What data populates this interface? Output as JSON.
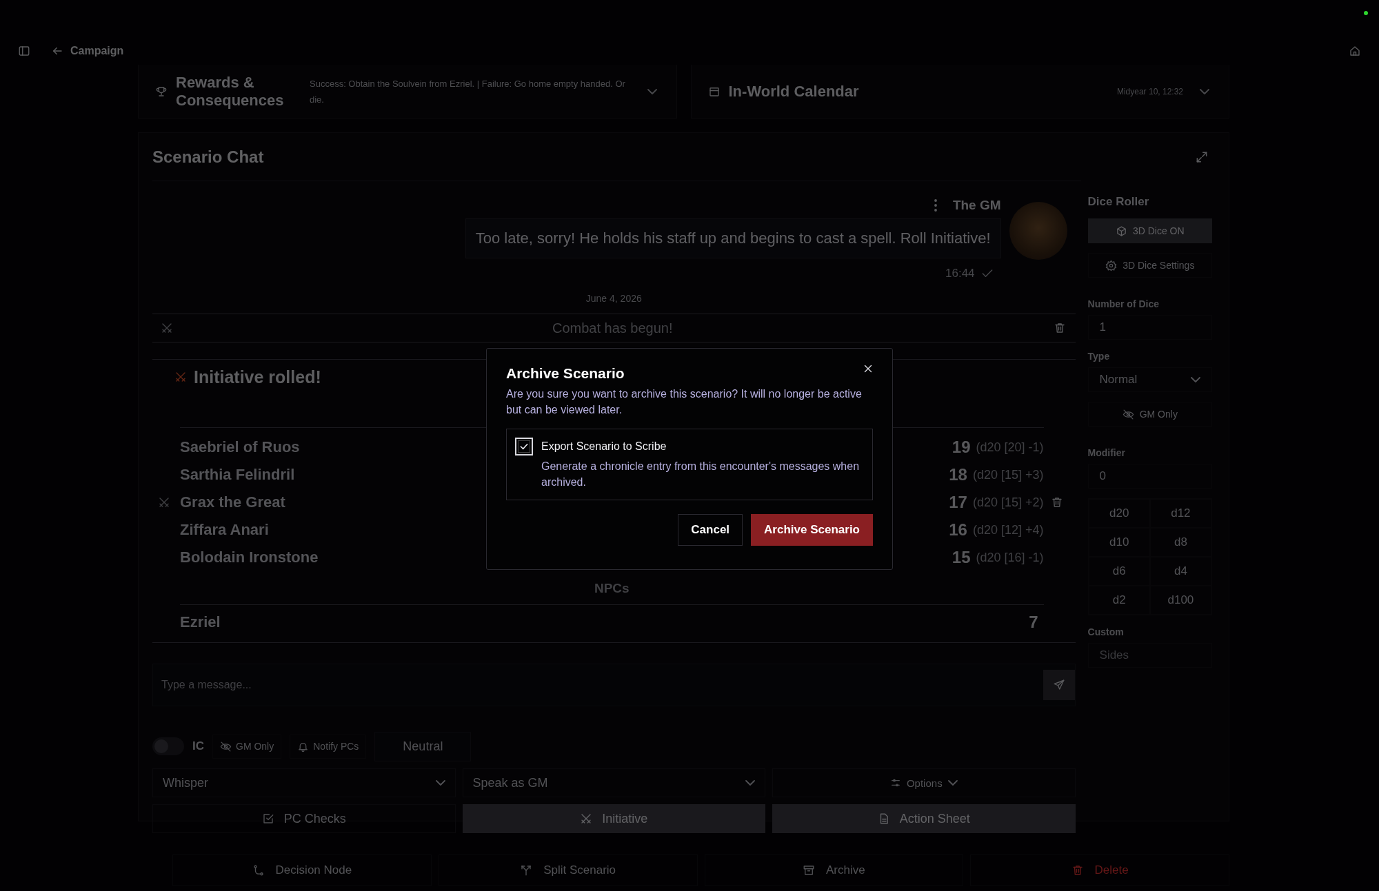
{
  "top_bar": {
    "back_label": "Campaign"
  },
  "summary_cards": [
    {
      "kind": "rewards",
      "title": "Rewards & Consequences",
      "text": "Success: Obtain the Soulvein from Ezriel. | Failure: Go home empty handed. Or die."
    },
    {
      "kind": "calendar",
      "title": "In-World Calendar",
      "value": "Midyear 10, 12:32"
    }
  ],
  "chat": {
    "title": "Scenario Chat",
    "messages": [
      {
        "author": "The GM",
        "text": "Too late, sorry! He holds his staff up and begins to cast a spell. Roll Initiative!",
        "time": "16:44",
        "read": true
      }
    ],
    "date_divider": "June 4, 2026",
    "combat_banner": "Combat has begun!",
    "initiative": {
      "title": "Initiative rolled!",
      "pcs": [
        {
          "name": "Saebriel of Ruos",
          "total": "19",
          "detail": "(d20 [20] -1)",
          "current": false
        },
        {
          "name": "Sarthia Felindril",
          "total": "18",
          "detail": "(d20 [15] +3)",
          "current": false
        },
        {
          "name": "Grax the Great",
          "total": "17",
          "detail": "(d20 [15] +2)",
          "current": true
        },
        {
          "name": "Ziffara Anari",
          "total": "16",
          "detail": "(d20 [12] +4)",
          "current": false
        },
        {
          "name": "Bolodain Ironstone",
          "total": "15",
          "detail": "(d20 [16] -1)",
          "current": false
        }
      ],
      "npc_heading": "NPCs",
      "npcs": [
        {
          "name": "Ezriel",
          "total": "7"
        }
      ]
    },
    "composer": {
      "placeholder": "Type a message...",
      "ic_toggle": {
        "label": "IC",
        "on": false
      },
      "gm_only": "GM Only",
      "notify": "Notify PCs",
      "tone": "Neutral",
      "whisper": "Whisper",
      "speaker": "Speak as GM",
      "options": "Options",
      "actions": [
        {
          "label": "PC Checks",
          "kind": "checks",
          "active": false
        },
        {
          "label": "Initiative",
          "kind": "initiative",
          "active": true
        },
        {
          "label": "Action Sheet",
          "kind": "sheet",
          "active": true
        }
      ]
    }
  },
  "dice_roller": {
    "title": "Dice Roller",
    "dice_3d": {
      "label": "3D Dice ON",
      "on": true
    },
    "settings": "3D Dice Settings",
    "count_label": "Number of Dice",
    "count": "1",
    "type_label": "Type",
    "type": "Normal",
    "gm_only": "GM Only",
    "modifier_label": "Modifier",
    "modifier": "0",
    "dice": [
      "d20",
      "d12",
      "d10",
      "d8",
      "d6",
      "d4",
      "d2",
      "d100"
    ],
    "custom_label": "Custom",
    "custom_placeholder": "Sides"
  },
  "footer_actions": [
    {
      "label": "Decision Node",
      "kind": "node"
    },
    {
      "label": "Split Scenario",
      "kind": "split"
    },
    {
      "label": "Archive",
      "kind": "archive"
    },
    {
      "label": "Delete",
      "kind": "delete"
    }
  ],
  "dialog": {
    "title": "Archive Scenario",
    "message": "Are you sure you want to archive this scenario? It will no longer be active but can be viewed later.",
    "option": {
      "label": "Export Scenario to Scribe",
      "description": "Generate a chronicle entry from this encounter's messages when archived.",
      "checked": true
    },
    "buttons": [
      {
        "label": "Cancel",
        "primary": false
      },
      {
        "label": "Archive Scenario",
        "primary": true
      }
    ]
  }
}
